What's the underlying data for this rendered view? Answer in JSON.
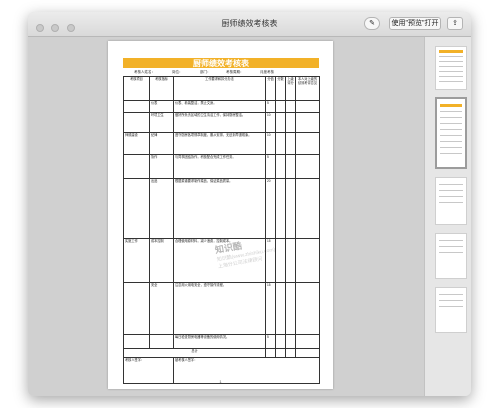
{
  "window": {
    "title": "厨师绩效考核表",
    "share_button": "使用\"预览\"打开",
    "colors": {
      "banner": "#f2b128",
      "titlebar": "#e4e4e4",
      "canvas": "#d0d0d0"
    }
  },
  "document": {
    "heading": "厨师绩效考核表",
    "sub_labels": [
      "考核人姓名：",
      "岗位：",
      "部门：",
      "考核周期：",
      "月度考核"
    ],
    "header": {
      "c1": "考核项目",
      "c2": "考核指标",
      "c3": "工作要求和扣分办法",
      "c4": "分值",
      "c5": "分数",
      "c6": "上级评分",
      "c7": "本人对上级的绩效考评意见"
    },
    "rows": [
      {
        "cat": "",
        "sub": "仪表",
        "text": "仪表、着装整洁，禁止文身。",
        "score": "5"
      },
      {
        "cat": "",
        "sub": "环境卫生",
        "text": "做好所负责区域的卫生清洁工作，保持厨房整洁。",
        "score": "10"
      },
      {
        "cat": "师德建设",
        "sub": "纪律",
        "text": "遵守厨房各项规章制度，服从安排，无迟到早退现象。",
        "score": "10"
      },
      {
        "cat": "",
        "sub": "协作",
        "text": "与同事团结协作，积极配合完成工作任务。",
        "score": "5"
      },
      {
        "cat": "",
        "sub": "出品",
        "text": "根据菜谱要求制作菜品，保证菜品质量。",
        "score": "20"
      },
      {
        "cat": "实施工作",
        "sub": "成本控制",
        "text": "合理使用原材料，减少浪费，控制成本。",
        "score": "15"
      },
      {
        "cat": "",
        "sub": "安全",
        "text": "注意用火用电安全，遵守操作流程。",
        "score": "15"
      },
      {
        "cat": "",
        "sub": "",
        "text": "每日检查厨房电器等设备的使用情况。",
        "score": "5"
      }
    ],
    "total_label": "总计",
    "signature_label": "考核人签字：",
    "confirm_label": "被考核人签字：",
    "page_number": "1"
  },
  "watermark": {
    "big": "知识酷",
    "line1": "知识酷(www.zhishiku.com)",
    "line2": "上海分公司法律顾问"
  },
  "sidebar": {
    "thumbnails": [
      "thumb-1",
      "thumb-2",
      "thumb-3",
      "thumb-4",
      "thumb-5"
    ]
  }
}
